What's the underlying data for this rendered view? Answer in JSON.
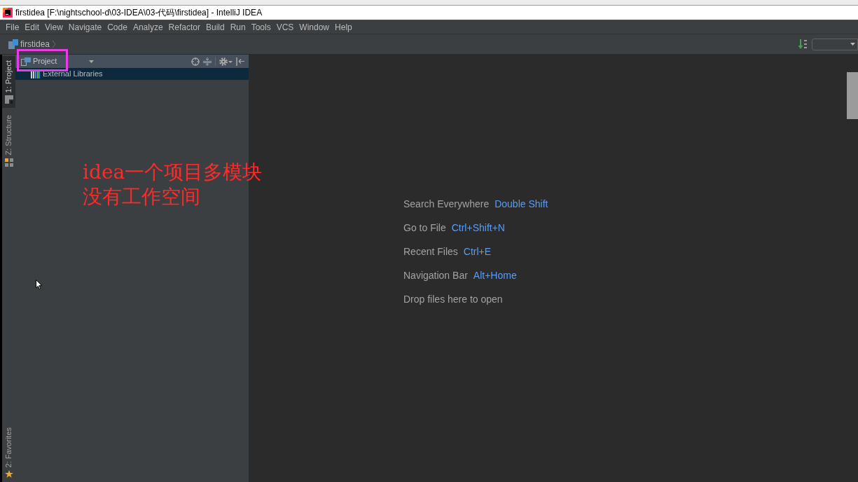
{
  "window": {
    "title": "firstidea [F:\\nightschool-d\\03-IDEA\\03-代码\\firstidea] - IntelliJ IDEA"
  },
  "menu": [
    "File",
    "Edit",
    "View",
    "Navigate",
    "Code",
    "Analyze",
    "Refactor",
    "Build",
    "Run",
    "Tools",
    "VCS",
    "Window",
    "Help"
  ],
  "navigation_bar": {
    "breadcrumbs": [
      "firstidea"
    ]
  },
  "tool_window_tabs": {
    "top": [
      {
        "label": "1: Project",
        "kind": "project",
        "selected": true
      },
      {
        "label": "Z: Structure",
        "kind": "structure",
        "selected": false
      }
    ],
    "bottom": [
      {
        "label": "2: Favorites",
        "kind": "favorites",
        "selected": false
      }
    ]
  },
  "project_panel": {
    "view": "Project",
    "tree": [
      {
        "label": "External Libraries",
        "selected": true
      }
    ]
  },
  "editor": {
    "hints": [
      {
        "action": "Search Everywhere",
        "shortcut": "Double Shift"
      },
      {
        "action": "Go to File",
        "shortcut": "Ctrl+Shift+N"
      },
      {
        "action": "Recent Files",
        "shortcut": "Ctrl+E"
      },
      {
        "action": "Navigation Bar",
        "shortcut": "Alt+Home"
      },
      {
        "action": "Drop files here to open"
      }
    ]
  },
  "annotation": {
    "lines": [
      "idea一个项目多模块",
      "没有工作空间"
    ]
  }
}
